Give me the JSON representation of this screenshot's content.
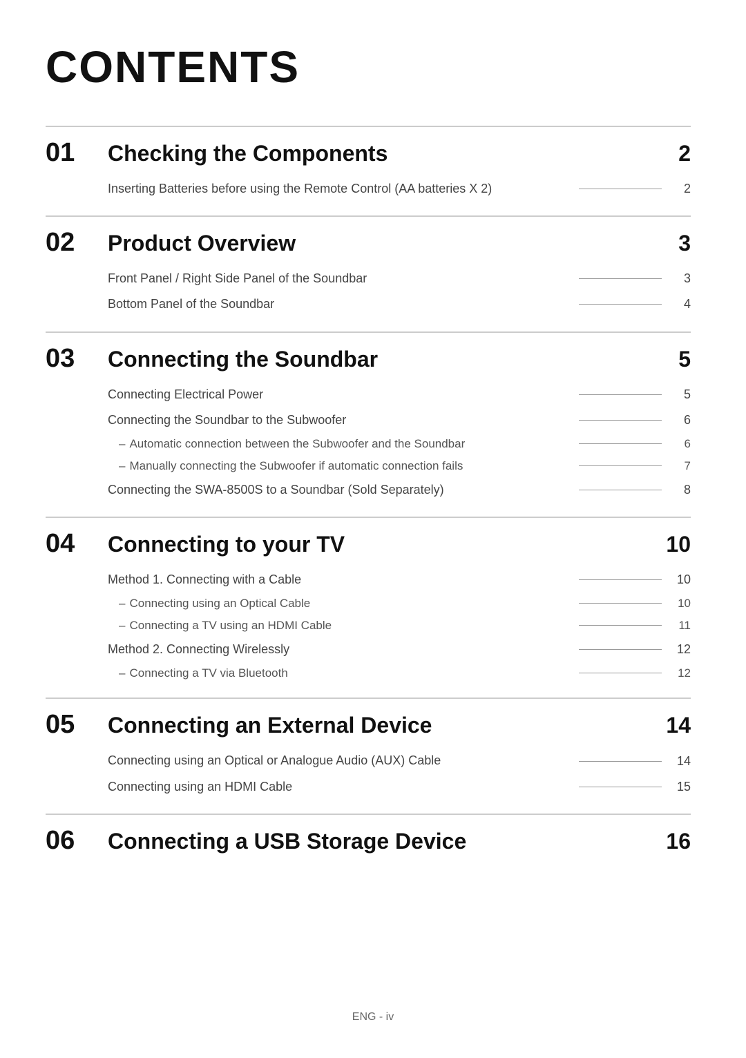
{
  "title": "CONTENTS",
  "sections": [
    {
      "number": "01",
      "title": "Checking the Components",
      "page": "2",
      "entries": [
        {
          "text": "Inserting Batteries before using the Remote Control (AA batteries X 2)",
          "page": "2",
          "sub": false
        }
      ]
    },
    {
      "number": "02",
      "title": "Product Overview",
      "page": "3",
      "entries": [
        {
          "text": "Front Panel / Right Side Panel of the Soundbar",
          "page": "3",
          "sub": false
        },
        {
          "text": "Bottom Panel of the Soundbar",
          "page": "4",
          "sub": false
        }
      ]
    },
    {
      "number": "03",
      "title": "Connecting the Soundbar",
      "page": "5",
      "entries": [
        {
          "text": "Connecting Electrical Power",
          "page": "5",
          "sub": false
        },
        {
          "text": "Connecting the Soundbar to the Subwoofer",
          "page": "6",
          "sub": false
        },
        {
          "text": "Automatic connection between the Subwoofer and the Soundbar",
          "page": "6",
          "sub": true
        },
        {
          "text": "Manually connecting the Subwoofer if automatic connection fails",
          "page": "7",
          "sub": true
        },
        {
          "text": "Connecting the SWA-8500S to a Soundbar (Sold Separately)",
          "page": "8",
          "sub": false
        }
      ]
    },
    {
      "number": "04",
      "title": "Connecting to your TV",
      "page": "10",
      "entries": [
        {
          "text": "Method 1. Connecting with a Cable",
          "page": "10",
          "sub": false
        },
        {
          "text": "Connecting using an Optical Cable",
          "page": "10",
          "sub": true
        },
        {
          "text": "Connecting a TV using an HDMI Cable",
          "page": "11",
          "sub": true
        },
        {
          "text": "Method 2. Connecting Wirelessly",
          "page": "12",
          "sub": false
        },
        {
          "text": "Connecting a TV via Bluetooth",
          "page": "12",
          "sub": true
        }
      ]
    },
    {
      "number": "05",
      "title": "Connecting an External Device",
      "page": "14",
      "entries": [
        {
          "text": "Connecting using an Optical or Analogue Audio (AUX) Cable",
          "page": "14",
          "sub": false
        },
        {
          "text": "Connecting using an HDMI Cable",
          "page": "15",
          "sub": false
        }
      ]
    },
    {
      "number": "06",
      "title": "Connecting a USB Storage Device",
      "page": "16",
      "entries": []
    }
  ],
  "footer": "ENG - iv"
}
